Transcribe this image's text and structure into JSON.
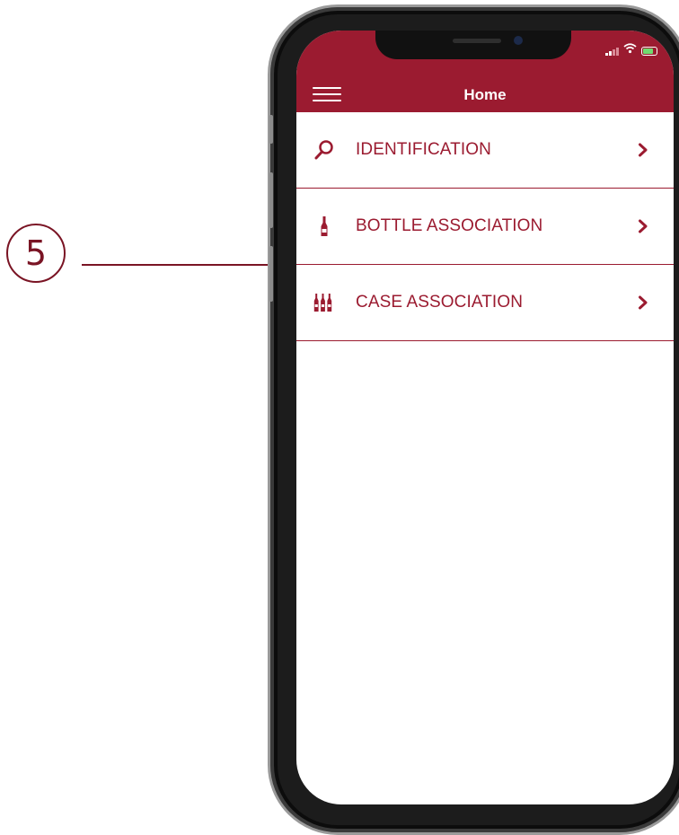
{
  "callout": {
    "number": "5"
  },
  "header": {
    "title": "Home",
    "menu_icon": "hamburger-menu-icon"
  },
  "status_bar": {
    "icons": [
      "cellular-signal-icon",
      "wifi-icon",
      "battery-charging-icon"
    ]
  },
  "menu": {
    "items": [
      {
        "label": "IDENTIFICATION",
        "icon": "magnifying-glass-icon"
      },
      {
        "label": "BOTTLE ASSOCIATION",
        "icon": "bottle-icon"
      },
      {
        "label": "CASE ASSOCIATION",
        "icon": "case-bottles-icon"
      }
    ]
  },
  "colors": {
    "accent": "#9b1b30",
    "callout": "#7a1424",
    "background": "#ffffff"
  }
}
